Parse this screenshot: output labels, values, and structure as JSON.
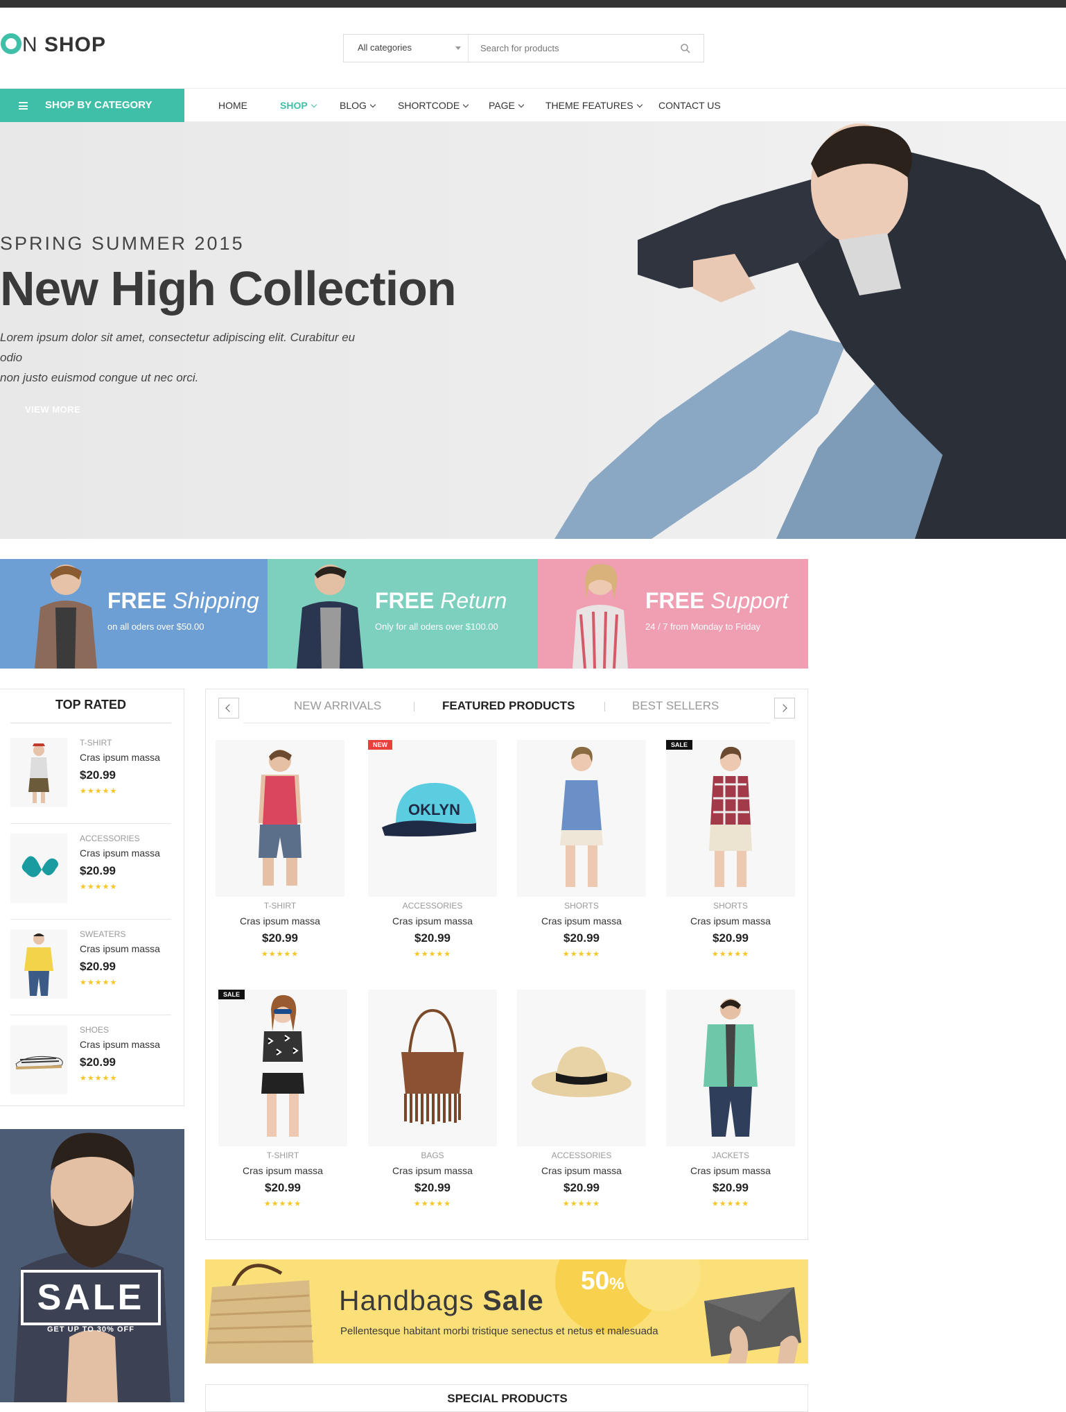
{
  "header": {
    "logo_text": "SHOP",
    "category_select": "All categories",
    "search_placeholder": "Search for products"
  },
  "nav": {
    "category_button": "SHOP BY CATEGORY",
    "items": [
      {
        "label": "HOME",
        "active": false,
        "dropdown": false
      },
      {
        "label": "SHOP",
        "active": true,
        "dropdown": true
      },
      {
        "label": "BLOG",
        "active": false,
        "dropdown": true
      },
      {
        "label": "SHORTCODE",
        "active": false,
        "dropdown": true
      },
      {
        "label": "PAGE",
        "active": false,
        "dropdown": true
      },
      {
        "label": "THEME FEATURES",
        "active": false,
        "dropdown": true
      },
      {
        "label": "CONTACT US",
        "active": false,
        "dropdown": false
      }
    ]
  },
  "hero": {
    "season": "SPRING SUMMER 2015",
    "title": "New High Collection",
    "text_line1": "Lorem ipsum dolor sit amet, consectetur adipiscing elit. Curabitur eu odio",
    "text_line2": "non justo euismod congue ut nec orci.",
    "button": "VIEW MORE"
  },
  "services": [
    {
      "bold": "FREE",
      "italic": "Shipping",
      "sub": "on all oders over $50.00",
      "color": "#6e9fd4"
    },
    {
      "bold": "FREE",
      "italic": "Return",
      "sub": "Only for all oders over $100.00",
      "color": "#7dcfbe"
    },
    {
      "bold": "FREE",
      "italic": "Support",
      "sub": "24 / 7 from Monday to Friday",
      "color": "#ef9fb1"
    }
  ],
  "top_rated": {
    "title": "TOP RATED",
    "items": [
      {
        "category": "T-SHIRT",
        "name": "Cras ipsum massa",
        "price": "$20.99",
        "stars": "★★★★★"
      },
      {
        "category": "ACCESSORIES",
        "name": "Cras ipsum massa",
        "price": "$20.99",
        "stars": "★★★★★"
      },
      {
        "category": "SWEATERS",
        "name": "Cras ipsum massa",
        "price": "$20.99",
        "stars": "★★★★★"
      },
      {
        "category": "SHOES",
        "name": "Cras ipsum massa",
        "price": "$20.99",
        "stars": "★★★★★"
      }
    ]
  },
  "sale_banner": {
    "word": "SALE",
    "sub": "GET UP TO 30% OFF"
  },
  "product_tabs": {
    "tabs": [
      "NEW ARRIVALS",
      "FEATURED PRODUCTS",
      "BEST SELLERS"
    ],
    "active_tab": "FEATURED PRODUCTS",
    "products": [
      {
        "category": "T-SHIRT",
        "name": "Cras ipsum massa",
        "price": "$20.99",
        "badge": "",
        "stars": "★★★★★"
      },
      {
        "category": "ACCESSORIES",
        "name": "Cras ipsum massa",
        "price": "$20.99",
        "badge": "NEW",
        "stars": "★★★★★"
      },
      {
        "category": "SHORTS",
        "name": "Cras ipsum massa",
        "price": "$20.99",
        "badge": "",
        "stars": "★★★★★"
      },
      {
        "category": "SHORTS",
        "name": "Cras ipsum massa",
        "price": "$20.99",
        "badge": "SALE",
        "stars": "★★★★★"
      },
      {
        "category": "T-SHIRT",
        "name": "Cras ipsum massa",
        "price": "$20.99",
        "badge": "SALE",
        "stars": "★★★★★"
      },
      {
        "category": "BAGS",
        "name": "Cras ipsum massa",
        "price": "$20.99",
        "badge": "",
        "stars": "★★★★★"
      },
      {
        "category": "ACCESSORIES",
        "name": "Cras ipsum massa",
        "price": "$20.99",
        "badge": "",
        "stars": "★★★★★"
      },
      {
        "category": "JACKETS",
        "name": "Cras ipsum massa",
        "price": "$20.99",
        "badge": "",
        "stars": "★★★★★"
      }
    ]
  },
  "handbag_banner": {
    "title_regular": "Handbags",
    "title_bold": "Sale",
    "percent": "50",
    "percent_sign": "%",
    "text": "Pellentesque habitant morbi tristique senectus et netus et malesuada"
  },
  "special": {
    "title": "SPECIAL PRODUCTS"
  },
  "colors": {
    "accent": "#3fbfa7",
    "new_badge": "#e9403b",
    "sale_badge": "#111111",
    "stars": "#f6c526"
  }
}
